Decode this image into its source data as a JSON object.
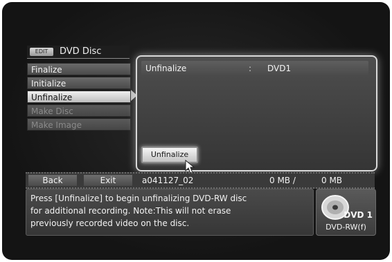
{
  "header": {
    "badge": "EDIT",
    "title": "DVD Disc"
  },
  "menu": {
    "items": [
      {
        "label": "Finalize",
        "state": "normal"
      },
      {
        "label": "Initialize",
        "state": "normal"
      },
      {
        "label": "Unfinalize",
        "state": "selected"
      },
      {
        "label": "Make Disc",
        "state": "disabled"
      },
      {
        "label": "Make Image",
        "state": "disabled"
      }
    ]
  },
  "panel": {
    "row": {
      "label": "Unfinalize",
      "separator": ":",
      "value": "DVD1"
    },
    "action_button": "Unfinalize"
  },
  "bottom_bar": {
    "back": "Back",
    "exit": "Exit",
    "filename": "a041127_02",
    "used": "0 MB /",
    "total": "0 MB"
  },
  "message": {
    "line1": "Press [Unfinalize] to begin unfinalizing DVD-RW disc",
    "line2": "for additional recording. Note:This will not erase",
    "line3": "previously recorded video on the disc."
  },
  "disc": {
    "name": "DVD 1",
    "type": "DVD-RW(f)"
  }
}
